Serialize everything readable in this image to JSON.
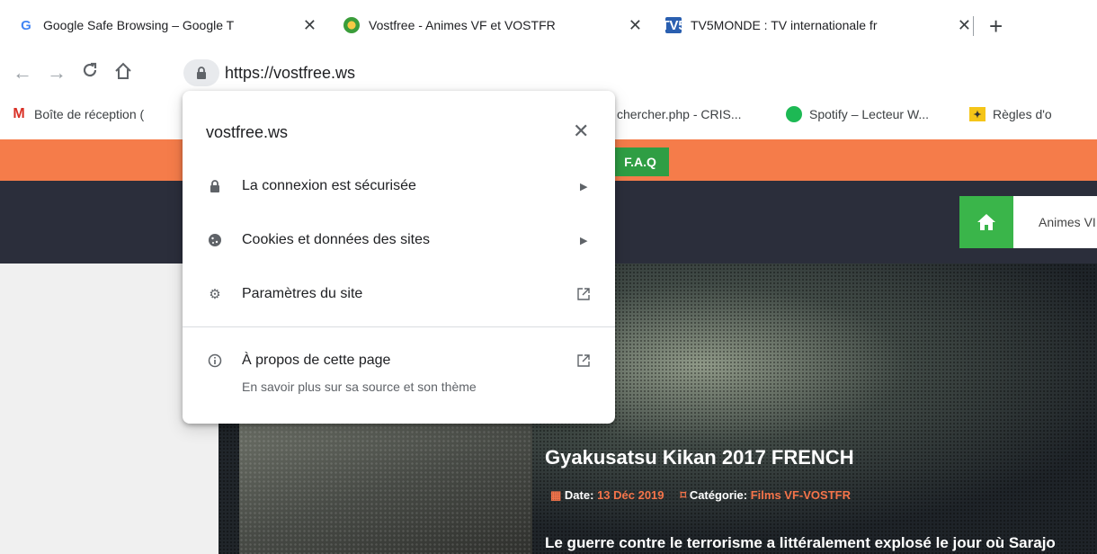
{
  "tabs": [
    {
      "title": "Google Safe Browsing – Google T",
      "icon": "google-g-icon",
      "favicon_text": "G"
    },
    {
      "title": "Vostfree - Animes VF et VOSTFR",
      "icon": "vostfree-icon",
      "favicon_text": ""
    },
    {
      "title": "TV5MONDE : TV internationale fr",
      "icon": "tv5monde-icon",
      "favicon_text": "TV5"
    }
  ],
  "toolbar": {
    "url": "https://vostfree.ws"
  },
  "bookmarks": [
    {
      "label": "Boîte de réception (",
      "icon": "gmail-icon",
      "icon_text": "M"
    },
    {
      "label": "chercher.php - CRIS...",
      "icon": "page-icon",
      "icon_text": ""
    },
    {
      "label": "Spotify – Lecteur W...",
      "icon": "spotify-icon",
      "icon_text": ""
    },
    {
      "label": "Règles d'o",
      "icon": "bookmark-icon",
      "icon_text": ""
    }
  ],
  "site": {
    "faq_label": "F.A.Q",
    "menu_item": "Animes VI",
    "hero_title": "Gyakusatsu Kikan 2017 FRENCH",
    "date_label": "Date:",
    "date_value": "13 Déc 2019",
    "category_label": "Catégorie:",
    "category_value": "Films VF-VOSTFR",
    "description": "Le guerre contre le terrorisme a littéralement explosé le jour où Sarajo"
  },
  "popup": {
    "domain": "vostfree.ws",
    "items": [
      {
        "label": "La connexion est sécurisée",
        "icon": "lock-icon",
        "trail": "arrow"
      },
      {
        "label": "Cookies et données des sites",
        "icon": "cookie-icon",
        "trail": "arrow"
      },
      {
        "label": "Paramètres du site",
        "icon": "gear-icon",
        "trail": "external"
      }
    ],
    "about": {
      "label": "À propos de cette page",
      "sublabel": "En savoir plus sur sa source et son thème",
      "icon": "info-icon"
    }
  },
  "colors": {
    "orange_bar": "#f57c4a",
    "dark_nav": "#2b2e3b",
    "green": "#3ab54a",
    "accent_orange": "#f5744a"
  }
}
